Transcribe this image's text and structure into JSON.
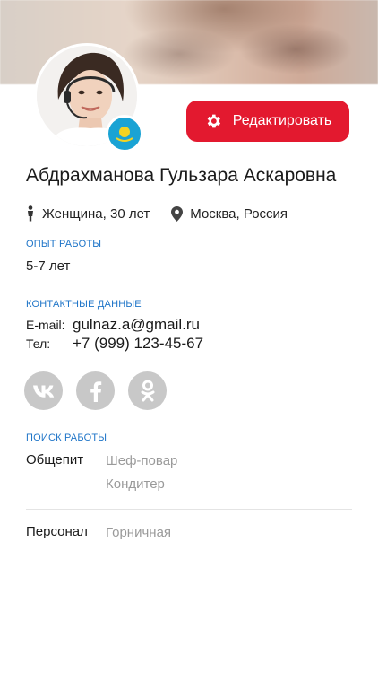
{
  "profile": {
    "full_name": "Абдрахманова Гульзара Аскаровна",
    "gender_age": "Женщина, 30 лет",
    "location": "Москва, Россия",
    "avatar": "woman-with-headset-photo",
    "flag": "kazakhstan-flag-icon"
  },
  "actions": {
    "edit_label": "Редактировать",
    "edit_icon": "gear-icon"
  },
  "experience": {
    "title": "ОПЫТ РАБОТЫ",
    "value": "5-7 лет"
  },
  "contacts": {
    "title": "КОНТАКТНЫЕ ДАННЫЕ",
    "email_label": "E-mail:",
    "email": "gulnaz.a@gmail.ru",
    "phone_label": "Тел:",
    "phone": "+7 (999) 123-45-67"
  },
  "socials": [
    {
      "name": "vk-icon",
      "glyph": "vk"
    },
    {
      "name": "facebook-icon",
      "glyph": "f"
    },
    {
      "name": "odnoklassniki-icon",
      "glyph": "ok"
    }
  ],
  "job_search": {
    "title": "ПОИСК РАБОТЫ",
    "groups": [
      {
        "category": "Общепит",
        "positions": [
          "Шеф-повар",
          "Кондитер"
        ]
      },
      {
        "category": "Персонал",
        "positions": [
          "Горничная"
        ]
      }
    ]
  },
  "colors": {
    "accent": "#e3192f",
    "section_title": "#1f75c8",
    "muted": "#9a9a9a",
    "social_bg": "#c8c8c8",
    "flag": "#1aa3d4"
  }
}
